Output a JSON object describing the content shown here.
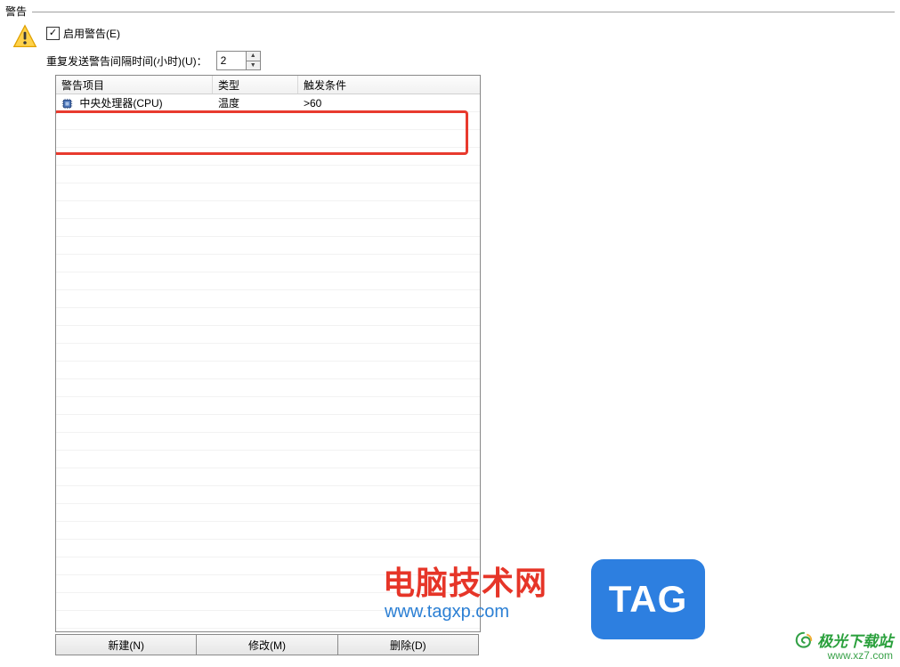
{
  "section": {
    "title": "警告"
  },
  "enable": {
    "label": "启用警告(E)",
    "checked": true
  },
  "interval": {
    "label": "重复发送警告间隔时间(小时)(U)：",
    "value": "2"
  },
  "table": {
    "headers": {
      "item": "警告项目",
      "type": "类型",
      "trigger": "触发条件"
    },
    "rows": [
      {
        "item": "中央处理器(CPU)",
        "type": "温度",
        "trigger": ">60",
        "icon": "cpu-icon"
      }
    ]
  },
  "buttons": {
    "new": "新建(N)",
    "edit": "修改(M)",
    "delete": "删除(D)"
  },
  "watermark1": {
    "line1": "电脑技术网",
    "line2": "www.tagxp.com"
  },
  "tag_badge": "TAG",
  "watermark2": {
    "line1": "极光下载站",
    "line2": "www.xz7.com"
  }
}
